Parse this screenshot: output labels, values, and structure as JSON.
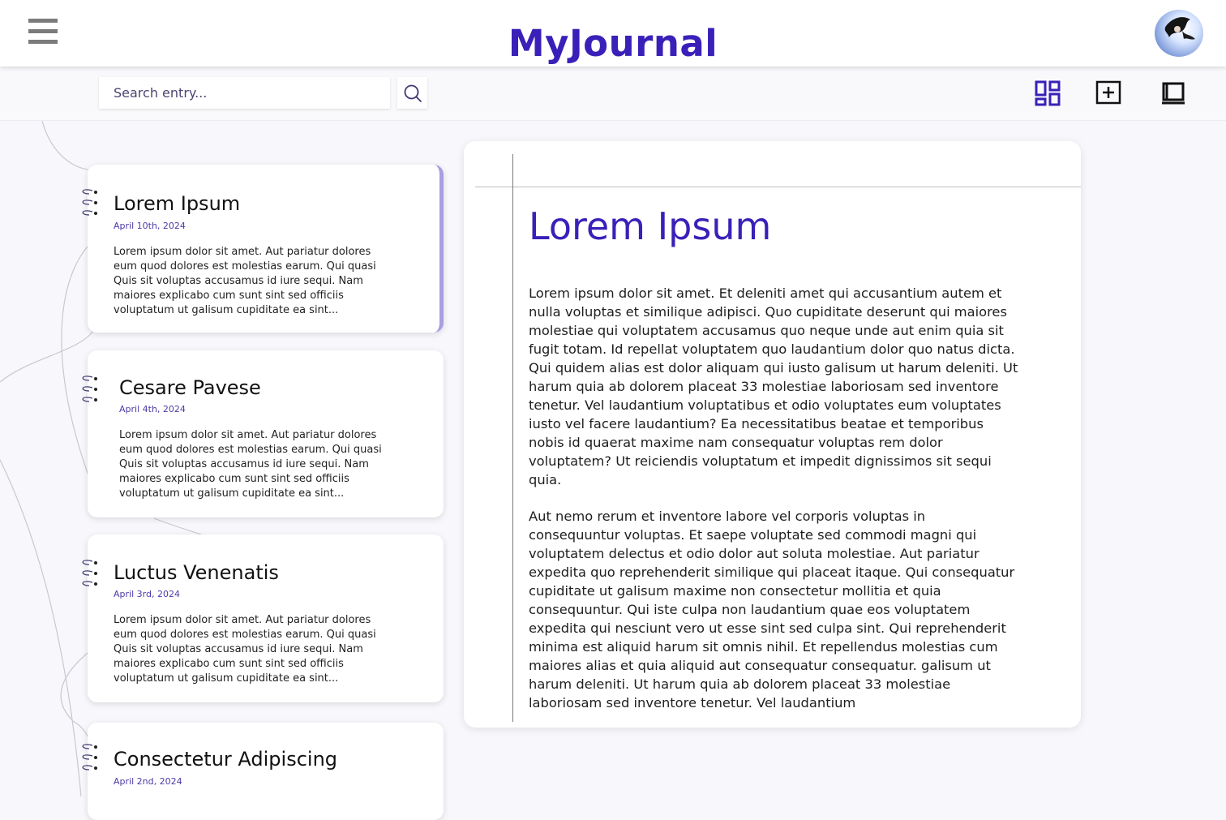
{
  "app": {
    "title": "MyJournal"
  },
  "search": {
    "placeholder": "Search entry..."
  },
  "entries": [
    {
      "title": "Lorem Ipsum",
      "date": "April 10th, 2024",
      "excerpt": "Lorem ipsum dolor sit amet. Aut pariatur dolores eum quod dolores est molestias earum. Qui quasi Quis sit voluptas accusamus id iure sequi. Nam maiores explicabo cum sunt sint sed officiis voluptatum ut galisum cupiditate ea sint..."
    },
    {
      "title": "Cesare Pavese",
      "date": "April 4th, 2024",
      "excerpt": "Lorem ipsum dolor sit amet. Aut pariatur dolores eum quod dolores est molestias earum. Qui quasi Quis sit voluptas accusamus id iure sequi. Nam maiores explicabo cum sunt sint sed officiis voluptatum ut galisum cupiditate ea sint..."
    },
    {
      "title": "Luctus Venenatis",
      "date": "April 3rd, 2024",
      "excerpt": "Lorem ipsum dolor sit amet. Aut pariatur dolores eum quod dolores est molestias earum. Qui quasi Quis sit voluptas accusamus id iure sequi. Nam maiores explicabo cum sunt sint sed officiis voluptatum ut galisum cupiditate ea sint..."
    },
    {
      "title": "Consectetur Adipiscing",
      "date": "April 2nd, 2024",
      "excerpt": ""
    }
  ],
  "reader": {
    "title": "Lorem Ipsum",
    "paragraphs": [
      "Lorem ipsum dolor sit amet. Et deleniti amet qui accusantium autem et nulla voluptas et similique adipisci. Quo cupiditate deserunt qui maiores molestiae qui voluptatem accusamus quo neque unde aut enim quia sit fugit totam. Id repellat voluptatem quo laudantium dolor quo natus dicta. Qui quidem alias est dolor aliquam qui iusto galisum ut harum deleniti. Ut harum quia ab dolorem placeat 33 molestiae laboriosam sed inventore tenetur. Vel laudantium voluptatibus et odio voluptates eum voluptates iusto vel facere laudantium? Ea necessitatibus beatae et temporibus nobis id quaerat maxime nam consequatur voluptas rem dolor voluptatem? Ut reiciendis voluptatum et impedit dignissimos sit sequi quia.",
      "Aut nemo rerum et inventore labore vel corporis voluptas in consequuntur voluptas. Et saepe voluptate sed commodi magni qui voluptatem delectus et odio dolor aut soluta molestiae. Aut pariatur expedita quo reprehenderit similique qui placeat itaque. Qui consequatur cupiditate ut galisum maxime non consectetur mollitia et quia consequuntur. Qui iste culpa non laudantium quae eos voluptatem expedita qui nesciunt vero ut esse sint sed culpa sint. Qui reprehenderit minima est aliquid harum sit omnis nihil. Et repellendus molestias cum maiores alias et quia aliquid aut consequatur consequatur. galisum ut harum deleniti. Ut harum quia ab dolorem placeat 33 molestiae laboriosam sed inventore tenetur. Vel laudantium"
    ]
  },
  "icons": {
    "menu": "hamburger-menu-icon",
    "search": "search-icon",
    "dashboard": "dashboard-icon",
    "new_entry": "add-entry-icon",
    "journal": "book-icon",
    "profile": "avatar"
  },
  "colors": {
    "brand": "#3a20b8",
    "accent": "#a79fe0",
    "date": "#4e3aa8"
  }
}
